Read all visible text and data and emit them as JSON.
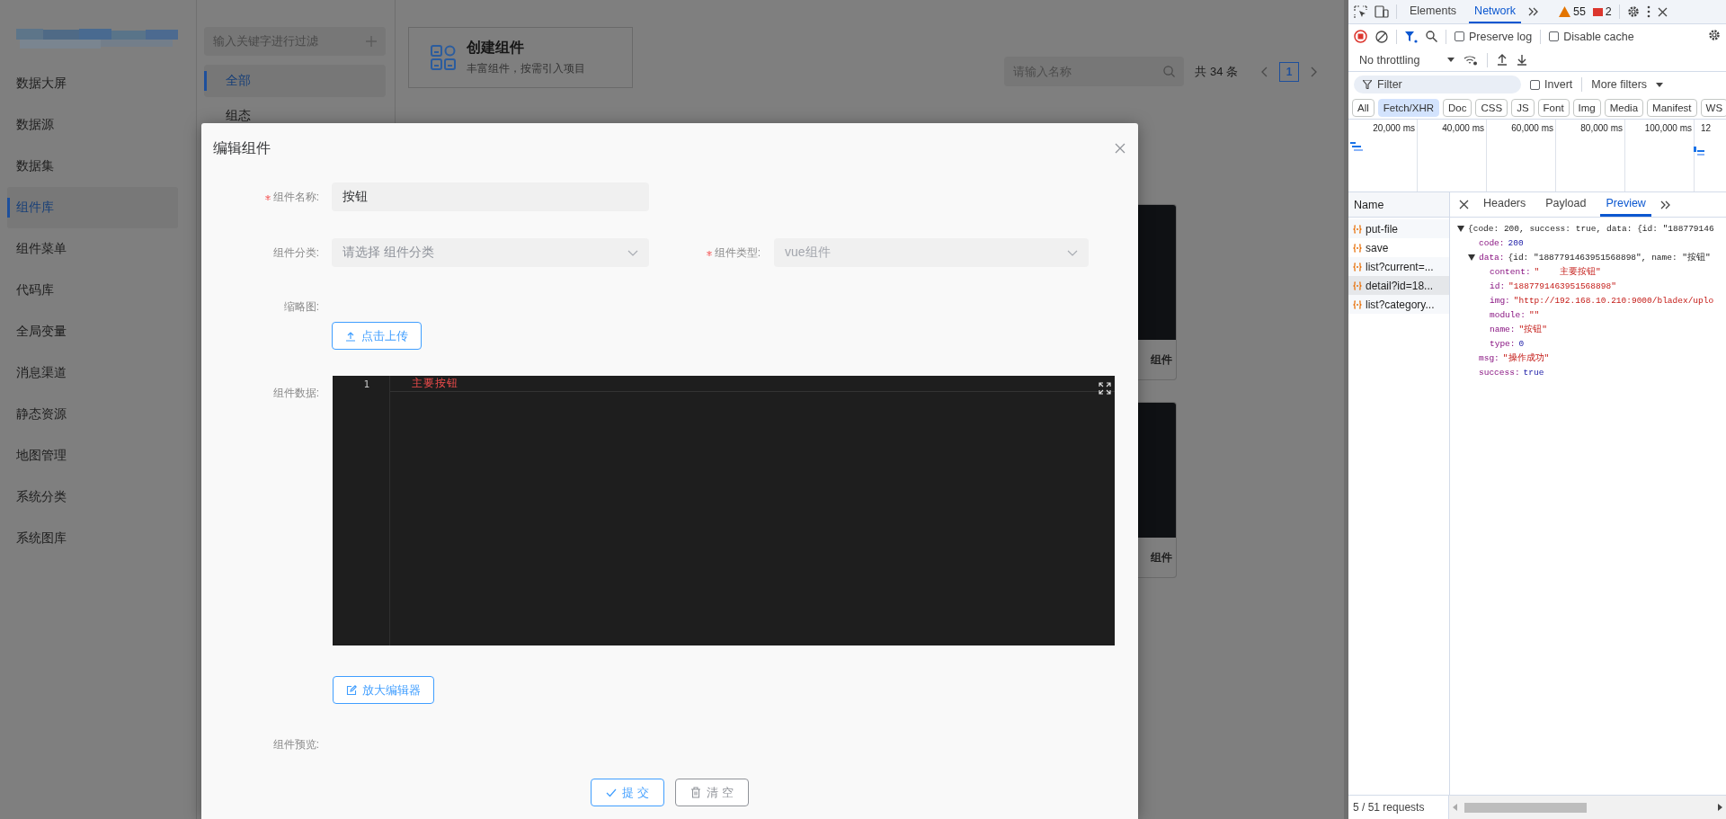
{
  "sidebar": {
    "items": [
      {
        "label": "数据大屏",
        "selected": false
      },
      {
        "label": "数据源",
        "selected": false
      },
      {
        "label": "数据集",
        "selected": false
      },
      {
        "label": "组件库",
        "selected": true
      },
      {
        "label": "组件菜单",
        "selected": false
      },
      {
        "label": "代码库",
        "selected": false
      },
      {
        "label": "全局变量",
        "selected": false
      },
      {
        "label": "消息渠道",
        "selected": false
      },
      {
        "label": "静态资源",
        "selected": false
      },
      {
        "label": "地图管理",
        "selected": false
      },
      {
        "label": "系统分类",
        "selected": false
      },
      {
        "label": "系统图库",
        "selected": false
      }
    ]
  },
  "category_panel": {
    "filter": {
      "placeholder": "输入关键字进行过滤"
    },
    "items": [
      {
        "label": "全部",
        "selected": true
      },
      {
        "label": "组态",
        "selected": false
      }
    ]
  },
  "content": {
    "create_card": {
      "title": "创建组件",
      "subtitle": "丰富组件，按需引入项目"
    },
    "search": {
      "placeholder": "请输入名称"
    },
    "total": "共 34 条",
    "pages": [
      {
        "label": "1",
        "selected": true
      }
    ],
    "cards": [
      {
        "label": "组件"
      },
      {
        "label": "组件"
      }
    ]
  },
  "dialog": {
    "title": "编辑组件",
    "fields": [
      {
        "label": "组件名称:",
        "required": true,
        "value": "按钮"
      },
      {
        "label": "组件分类:",
        "required": false,
        "placeholder": "请选择 组件分类"
      },
      {
        "label": "组件类型:",
        "required": true,
        "value": "vue组件",
        "disabled": true
      }
    ],
    "thumbnail": {
      "label": "缩略图:",
      "button": "点击上传"
    },
    "data": {
      "label": "组件数据:",
      "line_numbers": [
        "1"
      ],
      "code": "主要按钮"
    },
    "expand_button": "放大编辑器",
    "preview_label": "组件预览:",
    "buttons": [
      {
        "label": "提 交",
        "kind": "primary"
      },
      {
        "label": "清 空",
        "kind": "default"
      }
    ]
  },
  "devtools": {
    "tabs": [
      {
        "label": "Elements",
        "selected": false
      },
      {
        "label": "Network",
        "selected": true
      }
    ],
    "warnings": "55",
    "errors": "2",
    "options": [
      {
        "label": "Preserve log",
        "checked": false
      },
      {
        "label": "Disable cache",
        "checked": false
      }
    ],
    "throttling": "No throttling",
    "filter": {
      "placeholder": "Filter"
    },
    "invert": {
      "label": "Invert",
      "checked": false
    },
    "more_filters": "More filters",
    "type_filters": [
      {
        "label": "All",
        "selected": false
      },
      {
        "label": "Fetch/XHR",
        "selected": true
      },
      {
        "label": "Doc",
        "selected": false
      },
      {
        "label": "CSS",
        "selected": false
      },
      {
        "label": "JS",
        "selected": false
      },
      {
        "label": "Font",
        "selected": false
      },
      {
        "label": "Img",
        "selected": false
      },
      {
        "label": "Media",
        "selected": false
      },
      {
        "label": "Manifest",
        "selected": false
      },
      {
        "label": "WS",
        "selected": false
      }
    ],
    "timeline_ticks": [
      "20,000 ms",
      "40,000 ms",
      "60,000 ms",
      "80,000 ms",
      "100,000 ms",
      "12"
    ],
    "name_header": "Name",
    "detail_tabs": [
      {
        "label": "Headers",
        "selected": false
      },
      {
        "label": "Payload",
        "selected": false
      },
      {
        "label": "Preview",
        "selected": true
      }
    ],
    "requests": [
      {
        "name": "put-file",
        "selected": false
      },
      {
        "name": "save",
        "selected": false
      },
      {
        "name": "list?current=...",
        "selected": false
      },
      {
        "name": "detail?id=18...",
        "selected": true
      },
      {
        "name": "list?category...",
        "selected": false
      }
    ],
    "preview": {
      "summary": "{code: 200, success: true, data: {id: \"188779146",
      "expanded": true,
      "children": [
        {
          "key": "code:",
          "value": "200",
          "kind": "number"
        },
        {
          "key": "data:",
          "value": "{id: \"1887791463951568898\", name: \"按钮\"",
          "kind": "object",
          "expanded": true,
          "children": [
            {
              "key": "content:",
              "value": "\"    主要按钮\"",
              "kind": "string"
            },
            {
              "key": "id:",
              "value": "\"1887791463951568898\"",
              "kind": "string"
            },
            {
              "key": "img:",
              "value": "\"http://192.168.10.210:9000/bladex/uplo",
              "kind": "string"
            },
            {
              "key": "module:",
              "value": "\"\"",
              "kind": "string"
            },
            {
              "key": "name:",
              "value": "\"按钮\"",
              "kind": "string"
            },
            {
              "key": "type:",
              "value": "0",
              "kind": "number"
            }
          ]
        },
        {
          "key": "msg:",
          "value": "\"操作成功\"",
          "kind": "string"
        },
        {
          "key": "success:",
          "value": "true",
          "kind": "boolean"
        }
      ]
    },
    "status": "5 / 51 requests"
  }
}
